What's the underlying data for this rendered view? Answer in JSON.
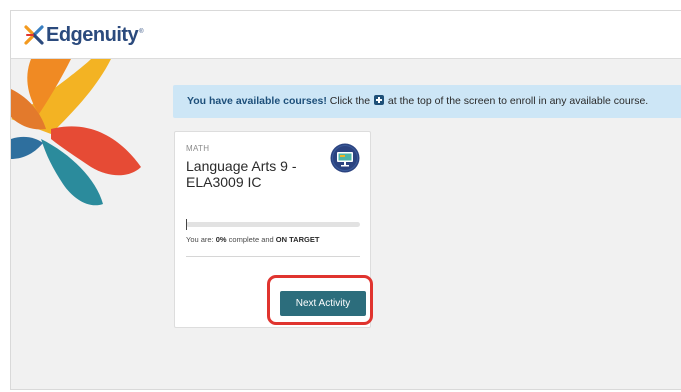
{
  "brand": {
    "name": "Edgenuity",
    "trademark": "®"
  },
  "notice": {
    "highlight": "You have available courses!",
    "before_icon": " Click the ",
    "icon": "plus-square-icon",
    "after_icon": " at the top of the screen to enroll in any available course."
  },
  "course": {
    "subject": "MATH",
    "title": "Language Arts 9 - ELA3009 IC",
    "icon": "classroom-screen-icon",
    "progress_percent": 0,
    "progress_prefix": "You are: ",
    "progress_value": "0%",
    "progress_middle": " complete and ",
    "progress_status": "ON TARGET",
    "next_label": "Next Activity"
  },
  "colors": {
    "brand_blue": "#2b4a7d",
    "notice_bg": "#cde6f6",
    "button_teal": "#2c6d7c",
    "highlight_red": "#e0342f"
  }
}
